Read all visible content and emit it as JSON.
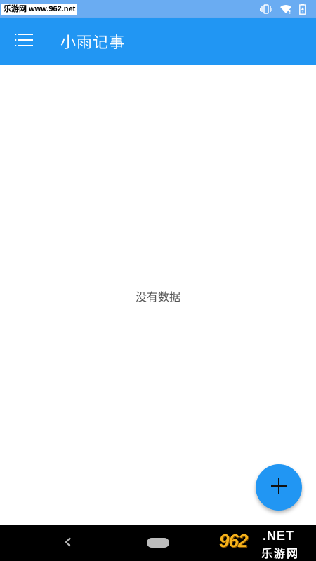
{
  "status_bar": {
    "watermark": "乐游网 www.962.net",
    "icons": [
      "vibrate-icon",
      "wifi-icon",
      "battery-icon"
    ]
  },
  "app_bar": {
    "menu_icon": "menu-icon",
    "title": "小雨记事"
  },
  "content": {
    "empty_text": "没有数据"
  },
  "fab": {
    "icon": "plus-icon"
  },
  "nav_bar": {
    "back_icon": "back-icon",
    "home_icon": "home-pill-icon"
  },
  "watermark_bottom": {
    "logo": "962",
    "suffix": ".NET",
    "cn": "乐游网"
  },
  "colors": {
    "status_bar": "#6aacf2",
    "primary": "#2196f3",
    "text_secondary": "#555555",
    "nav_bar": "#000000"
  }
}
